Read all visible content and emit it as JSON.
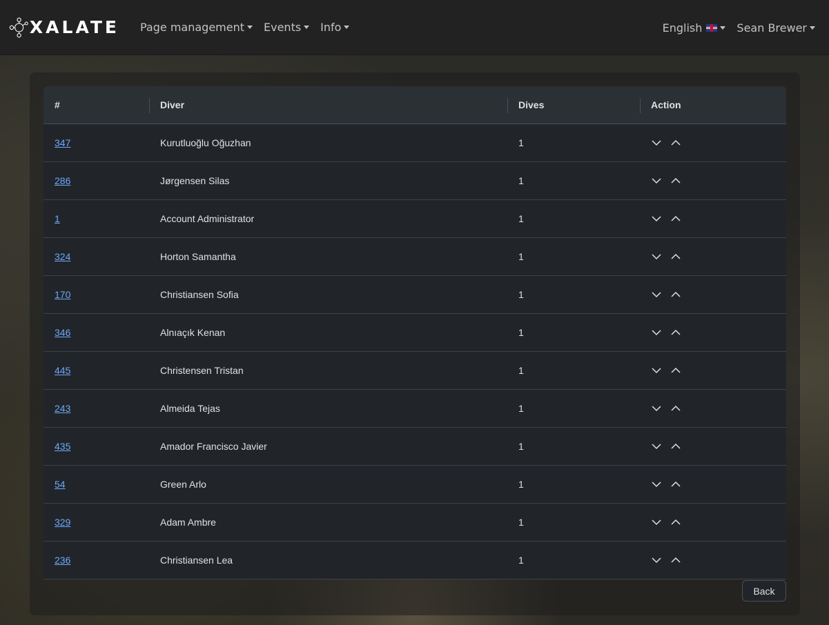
{
  "brand": {
    "name": "XALATE",
    "logo_icon": "molecule-logo-icon"
  },
  "nav": {
    "items": [
      {
        "label": "Page management"
      },
      {
        "label": "Events"
      },
      {
        "label": "Info"
      }
    ],
    "language": "English",
    "language_flag": "uk-flag-icon",
    "user": "Sean Brewer"
  },
  "table": {
    "headers": {
      "id": "#",
      "diver": "Diver",
      "dives": "Dives",
      "action": "Action"
    },
    "rows": [
      {
        "id": "347",
        "diver": "Kurutluoğlu Oğuzhan",
        "dives": "1"
      },
      {
        "id": "286",
        "diver": "Jørgensen Silas",
        "dives": "1"
      },
      {
        "id": "1",
        "diver": "Account Administrator",
        "dives": "1"
      },
      {
        "id": "324",
        "diver": "Horton Samantha",
        "dives": "1"
      },
      {
        "id": "170",
        "diver": "Christiansen Sofia",
        "dives": "1"
      },
      {
        "id": "346",
        "diver": "Alnıaçık Kenan",
        "dives": "1"
      },
      {
        "id": "445",
        "diver": "Christensen Tristan",
        "dives": "1"
      },
      {
        "id": "243",
        "diver": "Almeida Tejas",
        "dives": "1"
      },
      {
        "id": "435",
        "diver": "Amador Francisco Javier",
        "dives": "1"
      },
      {
        "id": "54",
        "diver": "Green Arlo",
        "dives": "1"
      },
      {
        "id": "329",
        "diver": "Adam Ambre",
        "dives": "1"
      },
      {
        "id": "236",
        "diver": "Christiansen Lea",
        "dives": "1"
      }
    ],
    "action_icons": [
      "chevron-down-icon",
      "chevron-up-icon"
    ]
  },
  "back_label": "Back",
  "colors": {
    "navbar": "#222222",
    "link": "#6ea8fe",
    "table_bg": "#212529"
  }
}
